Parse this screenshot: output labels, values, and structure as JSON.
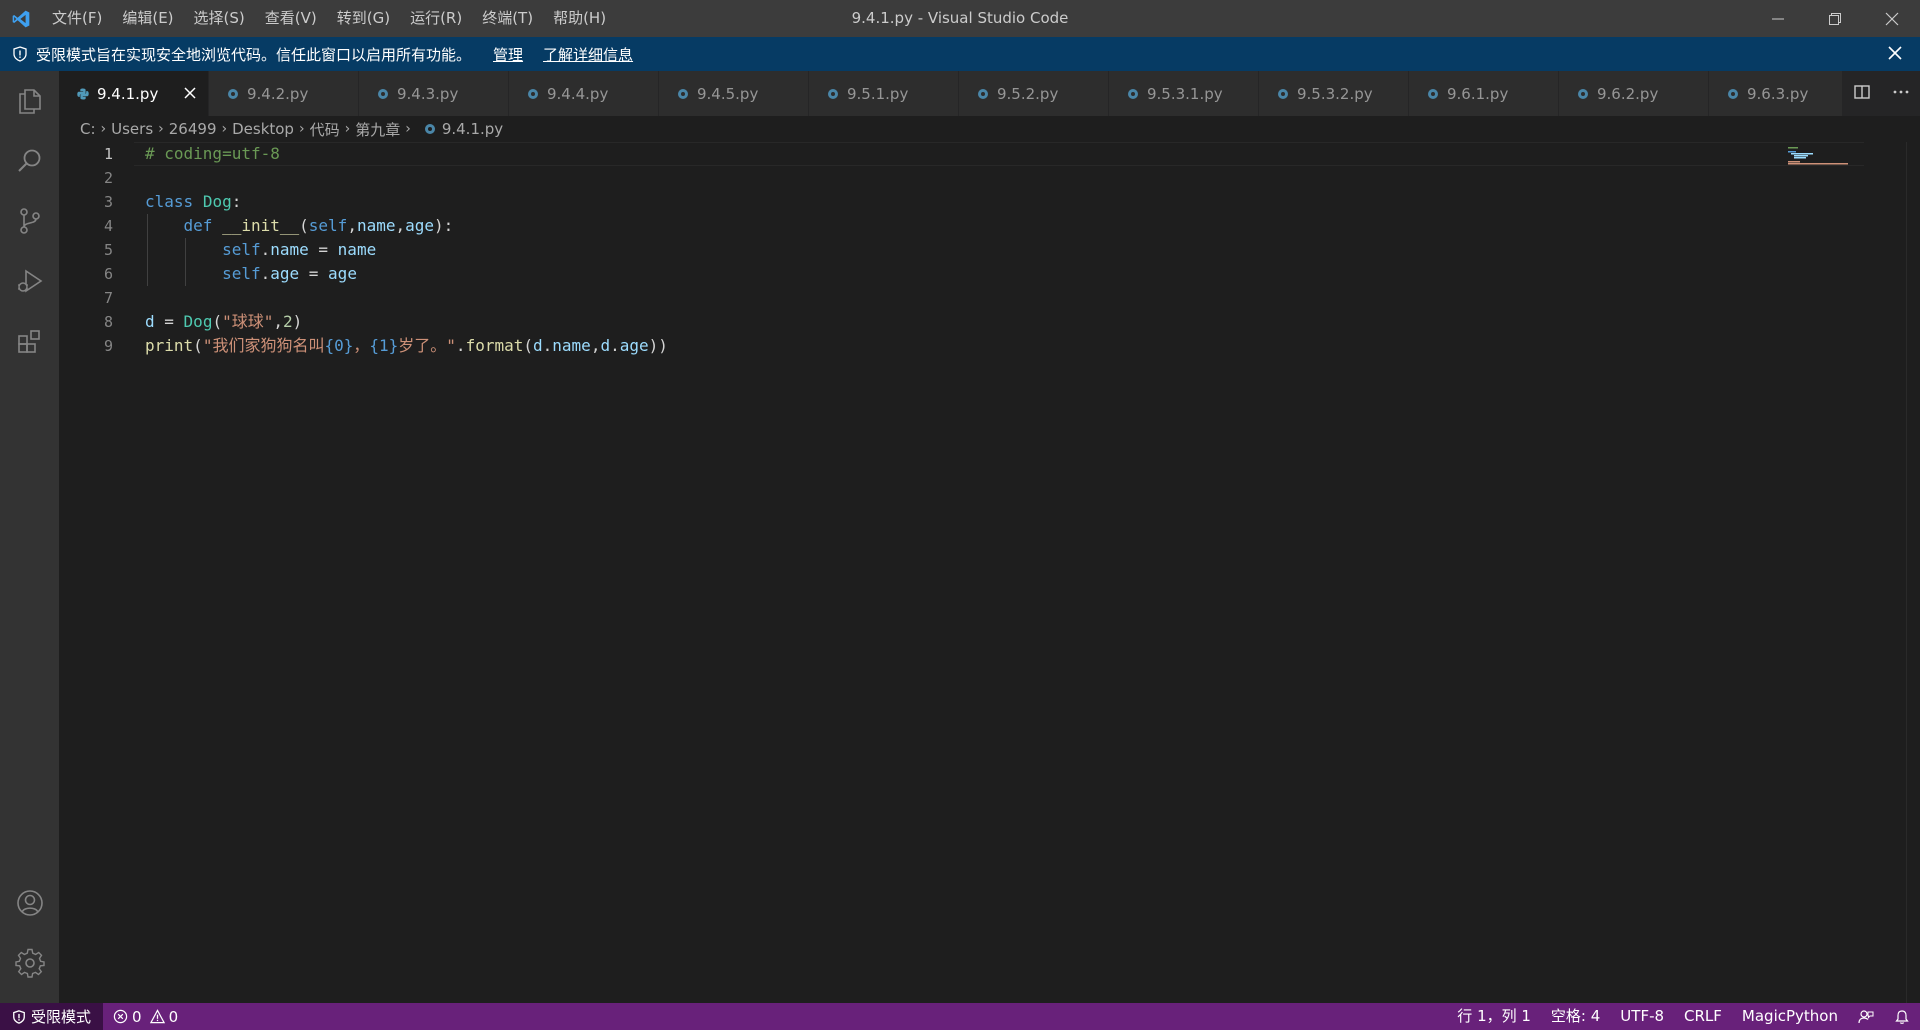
{
  "window": {
    "title": "9.4.1.py - Visual Studio Code",
    "menu": [
      "文件(F)",
      "编辑(E)",
      "选择(S)",
      "查看(V)",
      "转到(G)",
      "运行(R)",
      "终端(T)",
      "帮助(H)"
    ]
  },
  "banner": {
    "message": "受限模式旨在实现安全地浏览代码。信任此窗口以启用所有功能。",
    "manage_label": "管理",
    "learn_more_label": "了解详细信息"
  },
  "tabs": [
    {
      "label": "9.4.1.py",
      "active": true
    },
    {
      "label": "9.4.2.py",
      "active": false
    },
    {
      "label": "9.4.3.py",
      "active": false
    },
    {
      "label": "9.4.4.py",
      "active": false
    },
    {
      "label": "9.4.5.py",
      "active": false
    },
    {
      "label": "9.5.1.py",
      "active": false
    },
    {
      "label": "9.5.2.py",
      "active": false
    },
    {
      "label": "9.5.3.1.py",
      "active": false
    },
    {
      "label": "9.5.3.2.py",
      "active": false
    },
    {
      "label": "9.6.1.py",
      "active": false
    },
    {
      "label": "9.6.2.py",
      "active": false
    },
    {
      "label": "9.6.3.py",
      "active": false
    }
  ],
  "breadcrumb": [
    "C:",
    "Users",
    "26499",
    "Desktop",
    "代码",
    "第九章",
    "9.4.1.py"
  ],
  "editor": {
    "line_numbers": [
      "1",
      "2",
      "3",
      "4",
      "5",
      "6",
      "7",
      "8",
      "9"
    ],
    "lines": [
      "# coding=utf-8",
      "",
      "class Dog:",
      "    def __init__(self,name,age):",
      "        self.name = name",
      "        self.age = age",
      "",
      "d = Dog(\"球球\",2)",
      "print(\"我们家狗狗名叫{0}，{1}岁了。\".format(d.name,d.age))"
    ],
    "current_line": 1
  },
  "statusbar": {
    "restricted_label": "受限模式",
    "errors": "0",
    "warnings": "0",
    "position": "行 1，列 1",
    "spaces": "空格: 4",
    "encoding": "UTF-8",
    "eol": "CRLF",
    "language": "MagicPython"
  },
  "colors": {
    "titlebar": "#3c3c3c",
    "banner": "#063b64",
    "activitybar": "#333333",
    "editor_bg": "#1e1e1e",
    "statusbar": "#68217a",
    "keyword": "#569cd6",
    "string": "#ce9178",
    "comment": "#6a9955",
    "class": "#4ec9b0",
    "function": "#dcdcaa"
  }
}
